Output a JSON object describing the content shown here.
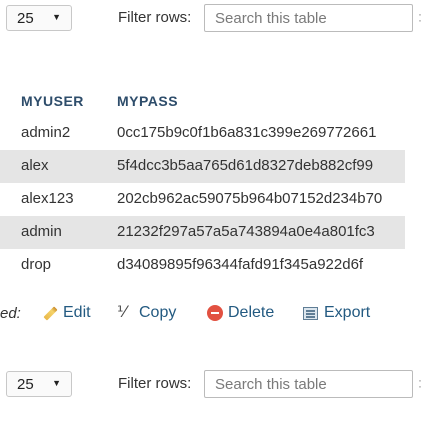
{
  "top_toolbar": {
    "rows_select_value": "25",
    "filter_label": "Filter rows:",
    "filter_placeholder": "Search this table"
  },
  "table": {
    "columns": [
      "MYUSER",
      "MYPASS"
    ],
    "rows": [
      [
        "admin2",
        "0cc175b9c0f1b6a831c399e269772661"
      ],
      [
        "alex",
        "5f4dcc3b5aa765d61d8327deb882cf99"
      ],
      [
        "alex123",
        "202cb962ac59075b964b07152d234b70"
      ],
      [
        "admin",
        "21232f297a57a5a743894a0e4a801fc3"
      ],
      [
        "drop",
        "d34089895f96344fafd91f345a922d6f"
      ]
    ]
  },
  "actions": {
    "prefix": "ed:",
    "edit_label": "Edit",
    "copy_label": "Copy",
    "delete_label": "Delete",
    "export_label": "Export"
  },
  "bottom_toolbar": {
    "rows_select_value": "25",
    "filter_label": "Filter rows:",
    "filter_placeholder": "Search this table"
  },
  "icons": {
    "edit": "pencil-icon",
    "copy": "copy-icon",
    "delete": "delete-icon",
    "export": "export-icon"
  },
  "colors": {
    "header_text": "#2e4d6b",
    "alt_row": "#e5e5e5",
    "action_link": "#235a81"
  }
}
